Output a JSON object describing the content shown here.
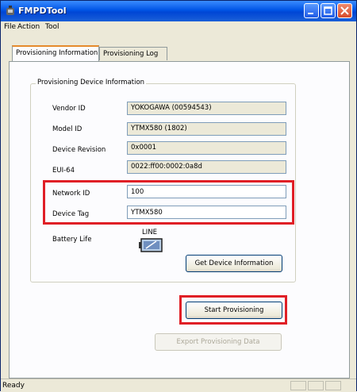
{
  "window": {
    "title": "FMPDTool"
  },
  "menu": [
    "File",
    "Action",
    "Tool"
  ],
  "tabs": [
    "Provisioning Information",
    "Provisioning Log"
  ],
  "group_title": "Provisioning Device Information",
  "fields": {
    "vendor_id": {
      "label": "Vendor ID",
      "value": "YOKOGAWA (00594543)"
    },
    "model_id": {
      "label": "Model ID",
      "value": "YTMX580 (1802)"
    },
    "device_revision": {
      "label": "Device Revision",
      "value": "0x0001"
    },
    "eui64": {
      "label": "EUI-64",
      "value": "0022:ff00:0002:0a8d"
    },
    "network_id": {
      "label": "Network ID",
      "value": "100"
    },
    "device_tag": {
      "label": "Device Tag",
      "value": "YTMX580"
    }
  },
  "battery": {
    "label": "Battery Life",
    "caption": "LINE"
  },
  "buttons": {
    "get_device_info": "Get Device Information",
    "start_provisioning": "Start Provisioning",
    "export_data": "Export Provisioning Data"
  },
  "status": "Ready",
  "colors": {
    "highlight": "#e01f26",
    "title_bar": "#0055e5",
    "active_tab_accent": "#e68b2c"
  }
}
